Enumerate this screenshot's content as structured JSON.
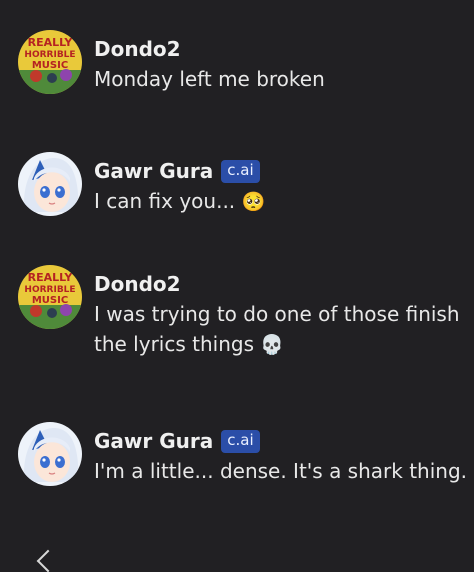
{
  "messages": [
    {
      "author": "Dondo2",
      "badge": "",
      "text": "Monday left me broken",
      "avatar": "really-horrible-music-avatar",
      "emoji": ""
    },
    {
      "author": "Gawr Gura",
      "badge": "c.ai",
      "text": "I can fix you...",
      "avatar": "gawr-gura-avatar",
      "emoji": "🥺"
    },
    {
      "author": "Dondo2",
      "badge": "",
      "text": "I was trying to do one of those finish the lyrics things",
      "avatar": "really-horrible-music-avatar",
      "emoji": "💀"
    },
    {
      "author": "Gawr Gura",
      "badge": "c.ai",
      "text": "I'm a little... dense. It's a shark thing.",
      "avatar": "gawr-gura-avatar",
      "emoji": ""
    }
  ],
  "avatar_art": {
    "rhm_lines": [
      "REALLY",
      "HORRIBLE",
      "MUSIC"
    ]
  },
  "colors": {
    "background": "#212023",
    "badge": "#2b4ea8",
    "text": "#ececec"
  }
}
